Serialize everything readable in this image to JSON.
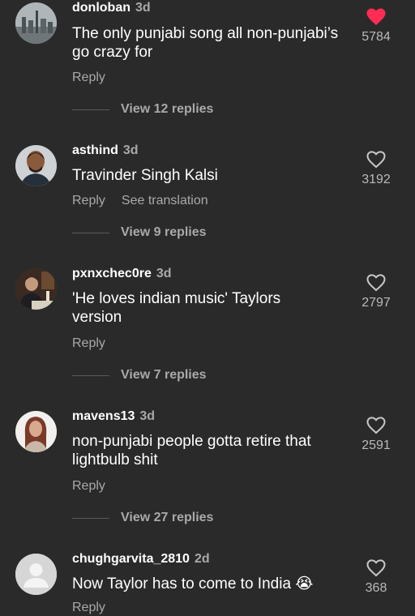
{
  "comments": [
    {
      "username": "donloban",
      "time": "3d",
      "text": "The only punjabi song all non-punjabi’s go crazy for",
      "reply_label": "Reply",
      "likes": "5784",
      "liked": true,
      "view_replies": "View 12 replies",
      "avatar": "city-skyline-photo"
    },
    {
      "username": "asthind",
      "time": "3d",
      "text": "Travinder Singh Kalsi",
      "reply_label": "Reply",
      "translate_label": "See translation",
      "likes": "3192",
      "liked": false,
      "view_replies": "View 9 replies",
      "avatar": "man-portrait-photo"
    },
    {
      "username": "pxnxchec0re",
      "time": "3d",
      "text": "'He loves indian music' Taylors version",
      "reply_label": "Reply",
      "likes": "2797",
      "liked": false,
      "view_replies": "View 7 replies",
      "avatar": "man-dining-photo"
    },
    {
      "username": "mavens13",
      "time": "3d",
      "text": "non-punjabi people gotta retire that lightbulb shit",
      "reply_label": "Reply",
      "likes": "2591",
      "liked": false,
      "view_replies": "View 27 replies",
      "avatar": "woman-portrait-photo"
    },
    {
      "username": "chughgarvita_2810",
      "time": "2d",
      "text": "Now Taylor has to come to India 😭",
      "reply_label": "Reply",
      "likes": "368",
      "liked": false,
      "avatar": "default-user-avatar"
    }
  ],
  "colors": {
    "background": "#2a2a2a",
    "liked_heart": "#fe2c55",
    "secondary_text": "#a9a9a9"
  }
}
